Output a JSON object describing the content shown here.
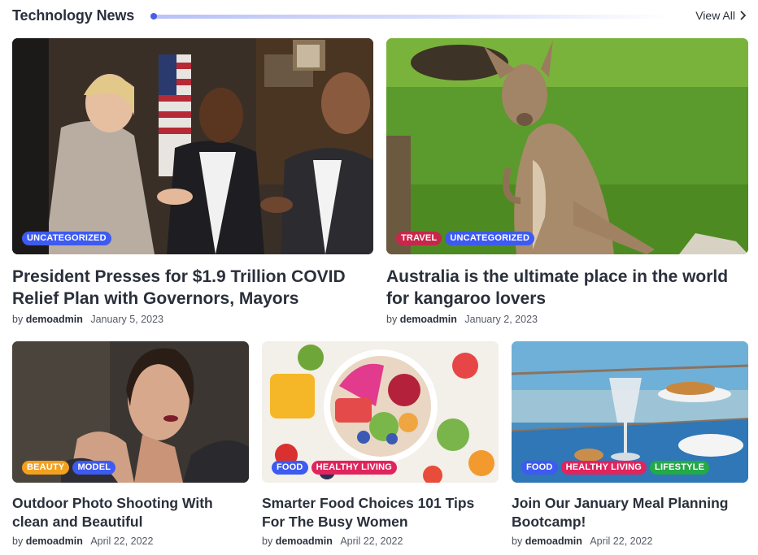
{
  "section": {
    "title": "Technology News",
    "view_all": "View All"
  },
  "colors": {
    "uncategorized": "#3d5af1",
    "travel": "#c8264b",
    "beauty": "#f2a01e",
    "model": "#3d5af1",
    "food": "#3d5af1",
    "healthy_living": "#e0245e",
    "lifestyle": "#23a947"
  },
  "posts": [
    {
      "title": "President Presses for $1.9 Trillion COVID Relief Plan with Governors, Mayors",
      "by": "by",
      "author": "demoadmin",
      "date": "January 5, 2023",
      "tags": [
        "UNCATEGORIZED"
      ]
    },
    {
      "title": "Australia is the ultimate place in the world for kangaroo lovers",
      "by": "by",
      "author": "demoadmin",
      "date": "January 2, 2023",
      "tags": [
        "TRAVEL",
        "UNCATEGORIZED"
      ]
    },
    {
      "title": "Outdoor Photo Shooting With clean and Beautiful",
      "by": "by",
      "author": "demoadmin",
      "date": "April 22, 2022",
      "tags": [
        "BEAUTY",
        "MODEL"
      ]
    },
    {
      "title": "Smarter Food Choices 101 Tips For The Busy Women",
      "by": "by",
      "author": "demoadmin",
      "date": "April 22, 2022",
      "tags": [
        "FOOD",
        "HEALTHY LIVING"
      ]
    },
    {
      "title": "Join Our January Meal Planning Bootcamp!",
      "by": "by",
      "author": "demoadmin",
      "date": "April 22, 2022",
      "tags": [
        "FOOD",
        "HEALTHY LIVING",
        "LIFESTYLE"
      ]
    }
  ]
}
